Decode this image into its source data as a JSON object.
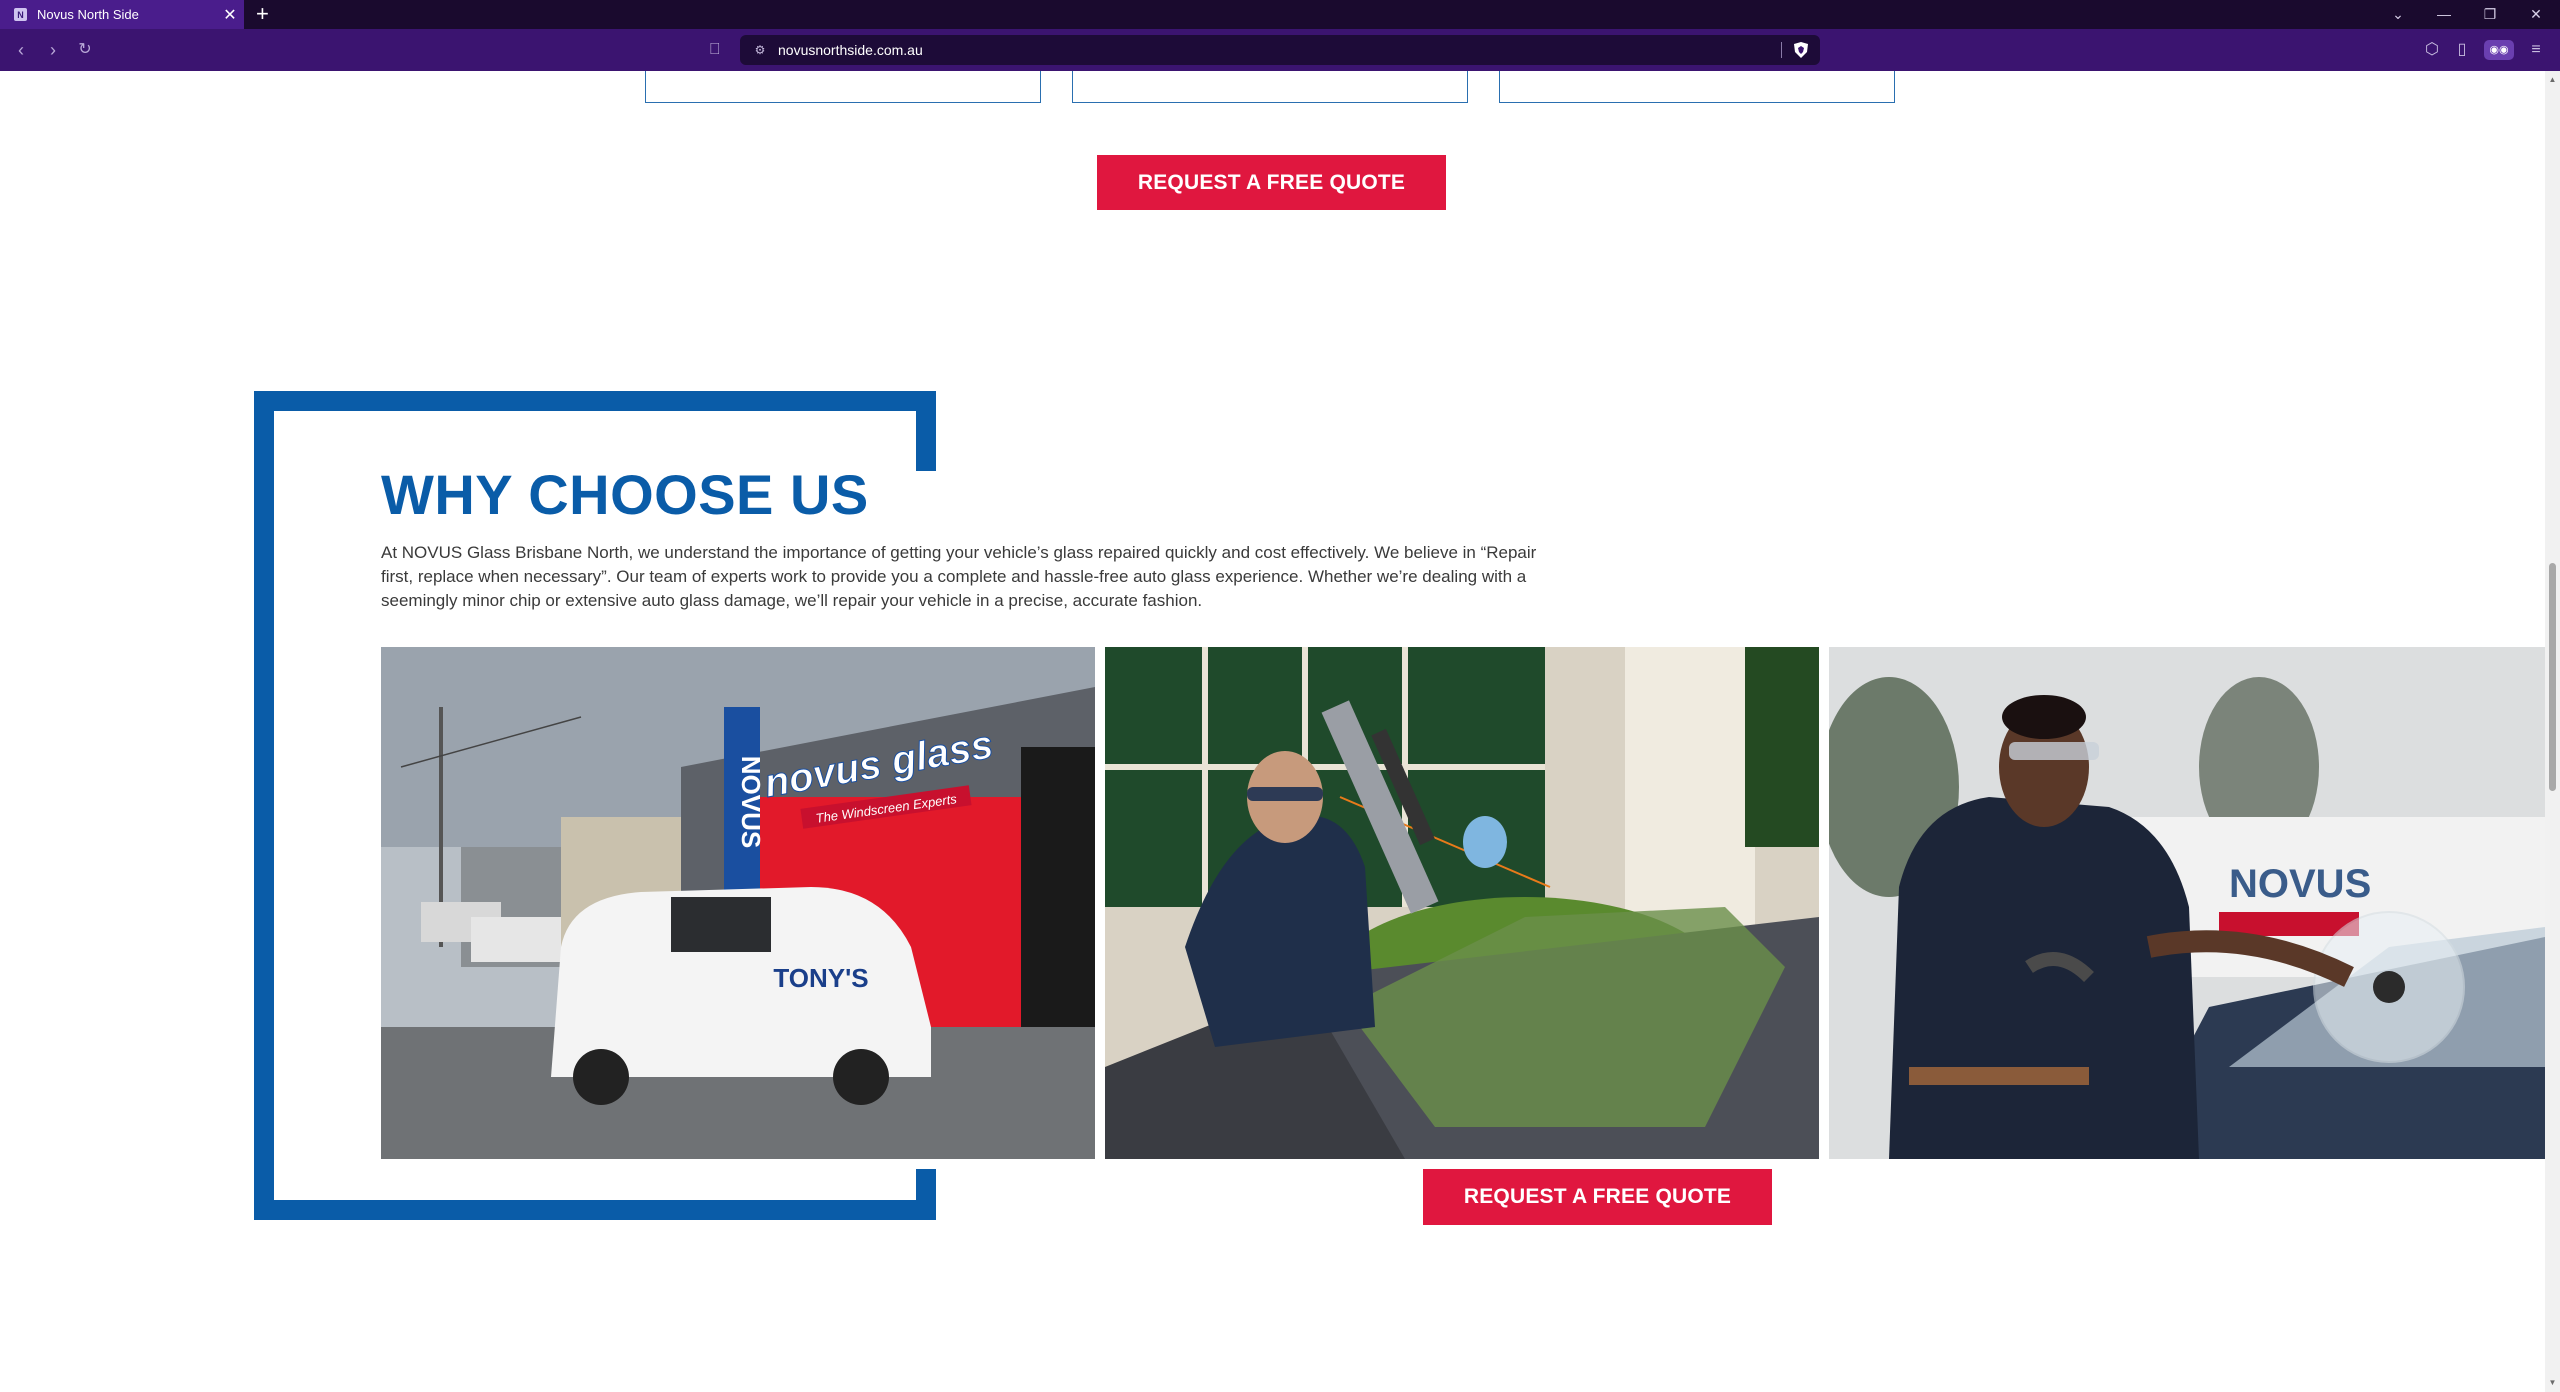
{
  "browser": {
    "tab_title": "Novus North Side",
    "url": "novusnorthside.com.au",
    "new_tab": "+",
    "tab_close": "✕"
  },
  "page": {
    "quote_button_top": "REQUEST A FREE QUOTE",
    "heading": "WHY CHOOSE US",
    "paragraph": "At NOVUS Glass Brisbane North, we understand the importance of getting your vehicle’s glass repaired quickly and cost effectively. We believe in “Repair first, replace when necessary”. Our team of experts work to provide you a complete and hassle-free auto glass experience. Whether we’re dealing with a seemingly minor chip or extensive auto glass damage, we’ll repair your vehicle in a precise, accurate fashion.",
    "quote_button_bottom": "REQUEST A FREE QUOTE",
    "photo1_sign": "NOVUS",
    "photo1_logo": "novus glass",
    "photo1_tagline": "The Windscreen Experts",
    "photo1_van_text": "TONY'S",
    "photo3_van_text": "NOVUS"
  },
  "colors": {
    "brand_blue": "#0a5ca8",
    "cta_red": "#e0173f",
    "chrome_purple": "#3b1470"
  },
  "icons": [
    "back-icon",
    "forward-icon",
    "reload-icon",
    "bookmark-icon",
    "site-info-icon",
    "brave-shield-icon",
    "extensions-icon",
    "sidebar-icon",
    "wallet-icon",
    "menu-icon",
    "minimize-icon",
    "maximize-icon",
    "close-window-icon",
    "tab-list-icon"
  ]
}
